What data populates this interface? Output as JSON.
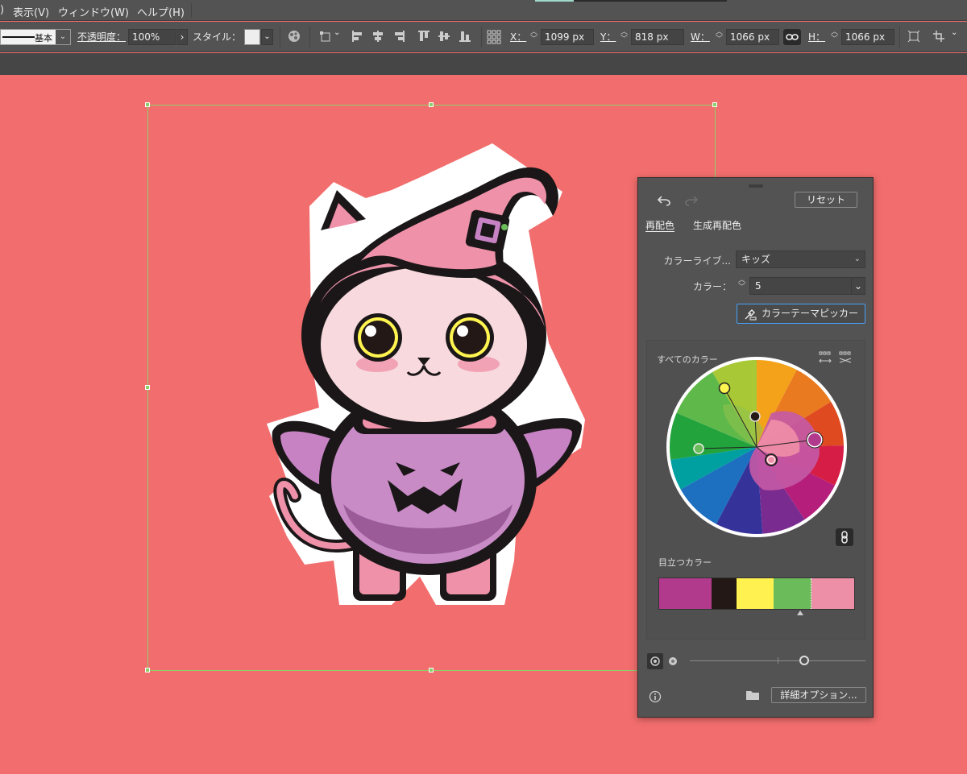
{
  "menu": {
    "partial_left": ")",
    "items": [
      "表示(V)",
      "ウィンドウ(W)",
      "ヘルプ(H)"
    ]
  },
  "toolbar": {
    "stroke_profile": "基本",
    "opacity_label": "不透明度：",
    "opacity_value": "100%",
    "style_label": "スタイル：",
    "x_label": "X：",
    "x_value": "1099 px",
    "y_label": "Y：",
    "y_value": "818 px",
    "w_label": "W：",
    "w_value": "1066 px",
    "h_label": "H：",
    "h_value": "1066 px",
    "icons": [
      "undo-arrow",
      "align-left",
      "align-center",
      "align-right",
      "align-top",
      "align-middle",
      "align-bottom",
      "transform-grid",
      "link",
      "artboard-constrain",
      "crop"
    ]
  },
  "panel": {
    "reset_label": "リセット",
    "tabs": [
      "再配色",
      "生成再配色"
    ],
    "active_tab": 0,
    "library_label": "カラーライブ...",
    "library_value": "キッズ",
    "color_count_label": "カラー：",
    "color_count_value": "5",
    "picker_label": "カラーテーマピッカー",
    "all_colors_label": "すべてのカラー",
    "prominent_label": "目立つカラー",
    "prominent_colors": [
      {
        "color": "#b23a8c",
        "share": 0.27
      },
      {
        "color": "#231815",
        "share": 0.13
      },
      {
        "color": "#fff150",
        "share": 0.19
      },
      {
        "color": "#6cbb5a",
        "share": 0.19
      },
      {
        "color": "#ee8fa8",
        "share": 0.22
      }
    ],
    "details_label": "詳細オプション..."
  },
  "colors": {
    "canvas": "#f26d6d",
    "chrome": "#535353",
    "selection": "#8bd16a",
    "accent_border": "#46a0f5"
  }
}
